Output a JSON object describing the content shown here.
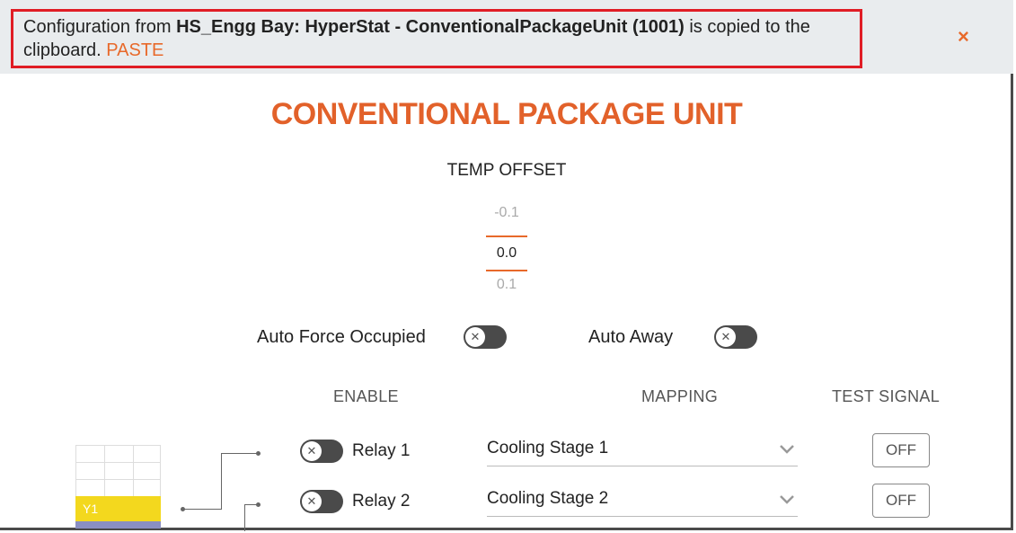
{
  "banner": {
    "prefix": "Configuration from ",
    "source": "HS_Engg Bay: HyperStat - ConventionalPackageUnit (1001)",
    "suffix": " is copied to the clipboard. ",
    "paste_label": "PASTE",
    "close_glyph": "×"
  },
  "title": "CONVENTIONAL PACKAGE UNIT",
  "temp_offset": {
    "label": "TEMP OFFSET",
    "prev": "-0.1",
    "current": "0.0",
    "next": "0.1"
  },
  "toggles": {
    "auto_force_occupied": {
      "label": "Auto Force Occupied",
      "state": "off"
    },
    "auto_away": {
      "label": "Auto Away",
      "state": "off"
    }
  },
  "columns": {
    "enable": "ENABLE",
    "mapping": "MAPPING",
    "test_signal": "TEST SIGNAL"
  },
  "relays": [
    {
      "label": "Relay 1",
      "enabled": "off",
      "mapping": "Cooling Stage 1",
      "test_signal": "OFF"
    },
    {
      "label": "Relay 2",
      "enabled": "off",
      "mapping": "Cooling Stage 2",
      "test_signal": "OFF"
    }
  ],
  "diagram": {
    "terminal_label": "Y1"
  },
  "icons": {
    "toggle_knob": "close-icon",
    "dropdown": "chevron-down-icon"
  },
  "colors": {
    "accent": "#e2612a",
    "highlight_border": "#e01d25",
    "toggle_track": "#4a4a4a",
    "terminal_yellow": "#f3d81e",
    "terminal_purple": "#8a8fc2"
  }
}
